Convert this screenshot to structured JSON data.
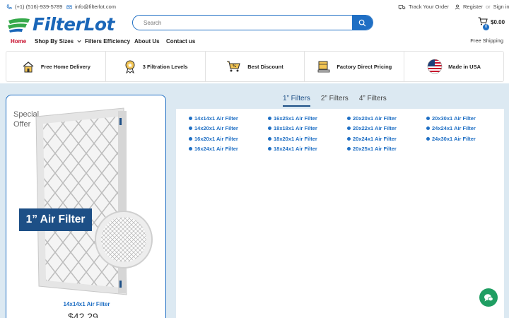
{
  "topbar": {
    "phone": "(+1) (516)-939-5789",
    "email": "info@filterlot.com",
    "track_order": "Track Your Order",
    "register": "Register",
    "or": "or",
    "sign_in": "Sign in"
  },
  "header": {
    "logo_text": "FilterLot",
    "search_placeholder": "Search",
    "cart_amount": "$0.00",
    "cart_count": "0"
  },
  "nav": {
    "items": [
      "Home",
      "Shop By Sizes",
      "Filters Efficiency",
      "About Us",
      "Contact us"
    ],
    "active": "Home",
    "free_shipping": "Free Shipping"
  },
  "features": [
    {
      "label": "Free Home Delivery",
      "icon": "house-delivery-icon"
    },
    {
      "label": "3 Filtration Levels",
      "icon": "award-badge-icon"
    },
    {
      "label": "Best Discount",
      "icon": "discount-cart-icon"
    },
    {
      "label": "Factory Direct Pricing",
      "icon": "factory-box-icon"
    },
    {
      "label": "Made in USA",
      "icon": "us-flag-icon"
    }
  ],
  "offer": {
    "special": "Special Offer",
    "banner": "1” Air Filter",
    "product_name": "14x14x1 Air Filter",
    "price": "$42.29"
  },
  "tabs": [
    "1” Filters",
    "2” Filters",
    "4” Filters"
  ],
  "active_tab": "1” Filters",
  "filters": [
    "14x14x1 Air Filter",
    "16x25x1 Air Filter",
    "20x20x1 Air Filter",
    "20x30x1 Air Filter",
    "14x20x1 Air Filter",
    "18x18x1 Air Filter",
    "20x22x1 Air Filter",
    "24x24x1 Air Filter",
    "16x20x1 Air Filter",
    "18x20x1 Air Filter",
    "20x24x1 Air Filter",
    "24x30x1 Air Filter",
    "16x24x1 Air Filter",
    "18x24x1 Air Filter",
    "20x25x1 Air Filter"
  ],
  "colors": {
    "brand": "#1f6fc4",
    "navy": "#1d4f86",
    "active_nav": "#c8102e",
    "chat": "#1f9e62",
    "background": "#dce9f2"
  }
}
